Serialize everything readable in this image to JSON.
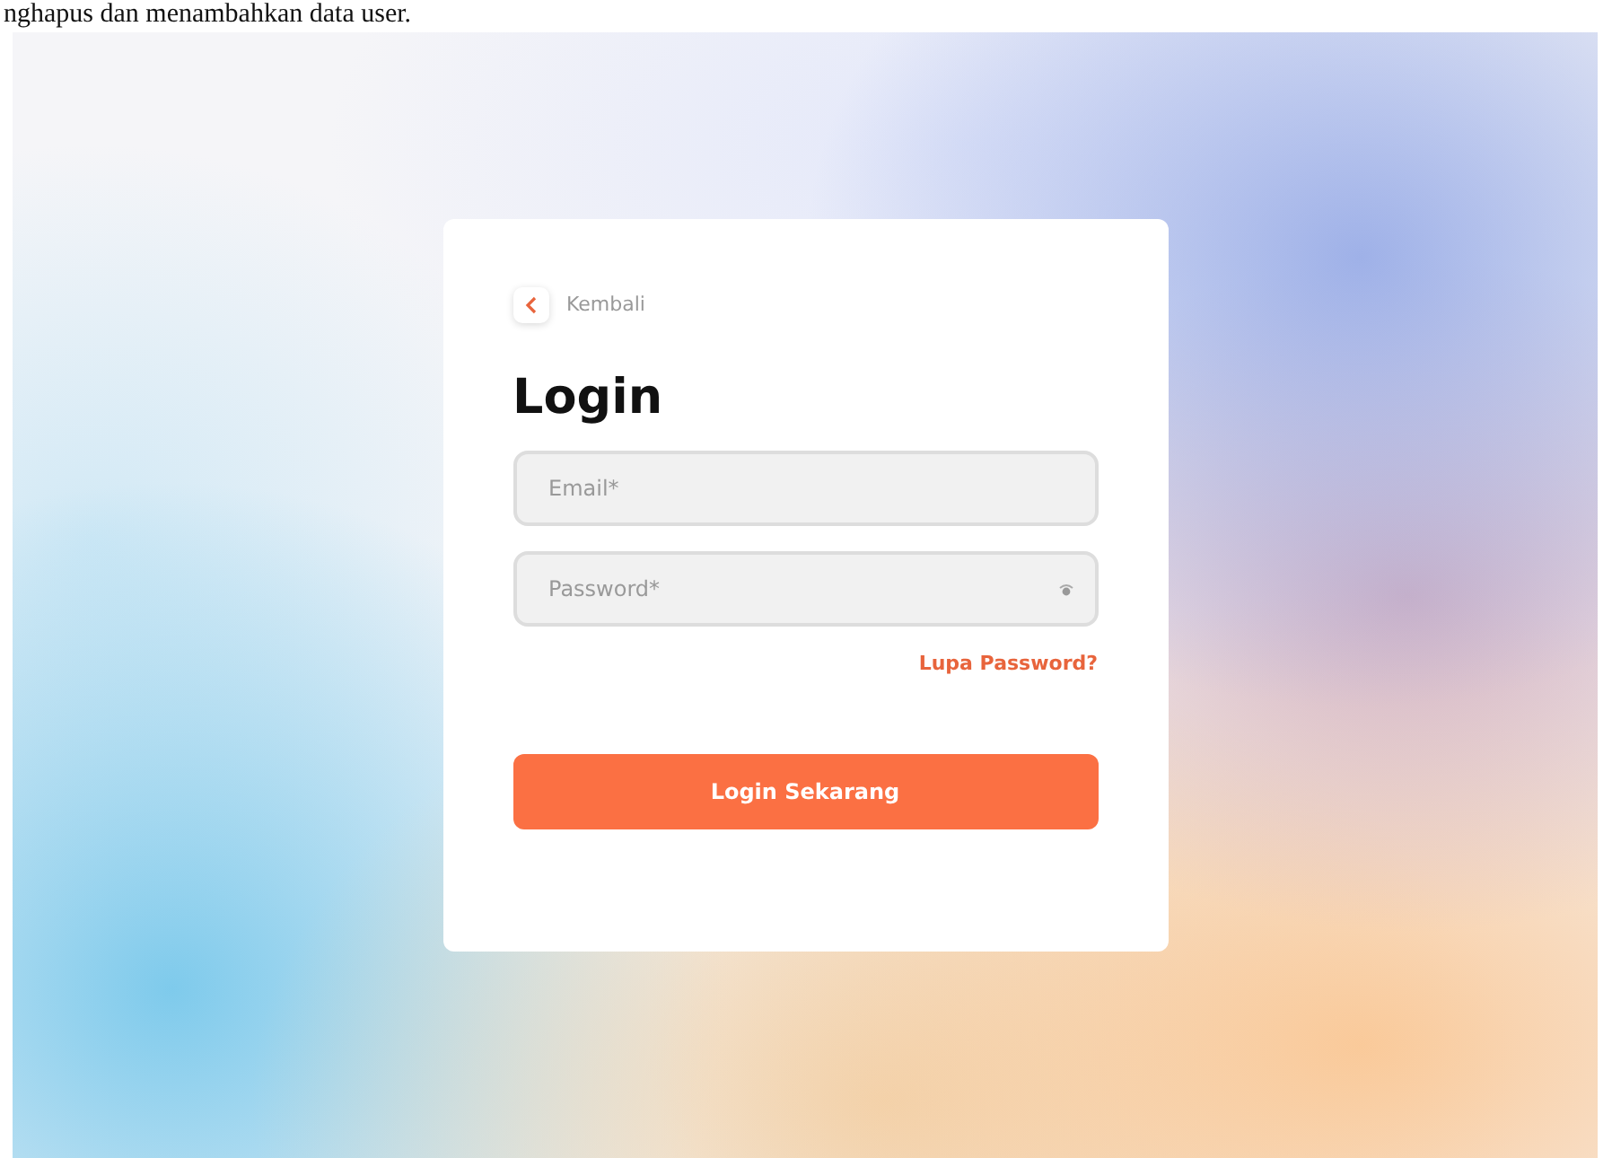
{
  "document_text": "nghapus dan menambahkan data user.",
  "login_card": {
    "back_link": "Kembali",
    "title": "Login",
    "fields": [
      {
        "kind": "text",
        "placeholder": "Email*"
      },
      {
        "kind": "password",
        "placeholder": "Password*"
      }
    ],
    "forgot_link": "Lupa Password?",
    "submit_button": "Login Sekarang"
  }
}
